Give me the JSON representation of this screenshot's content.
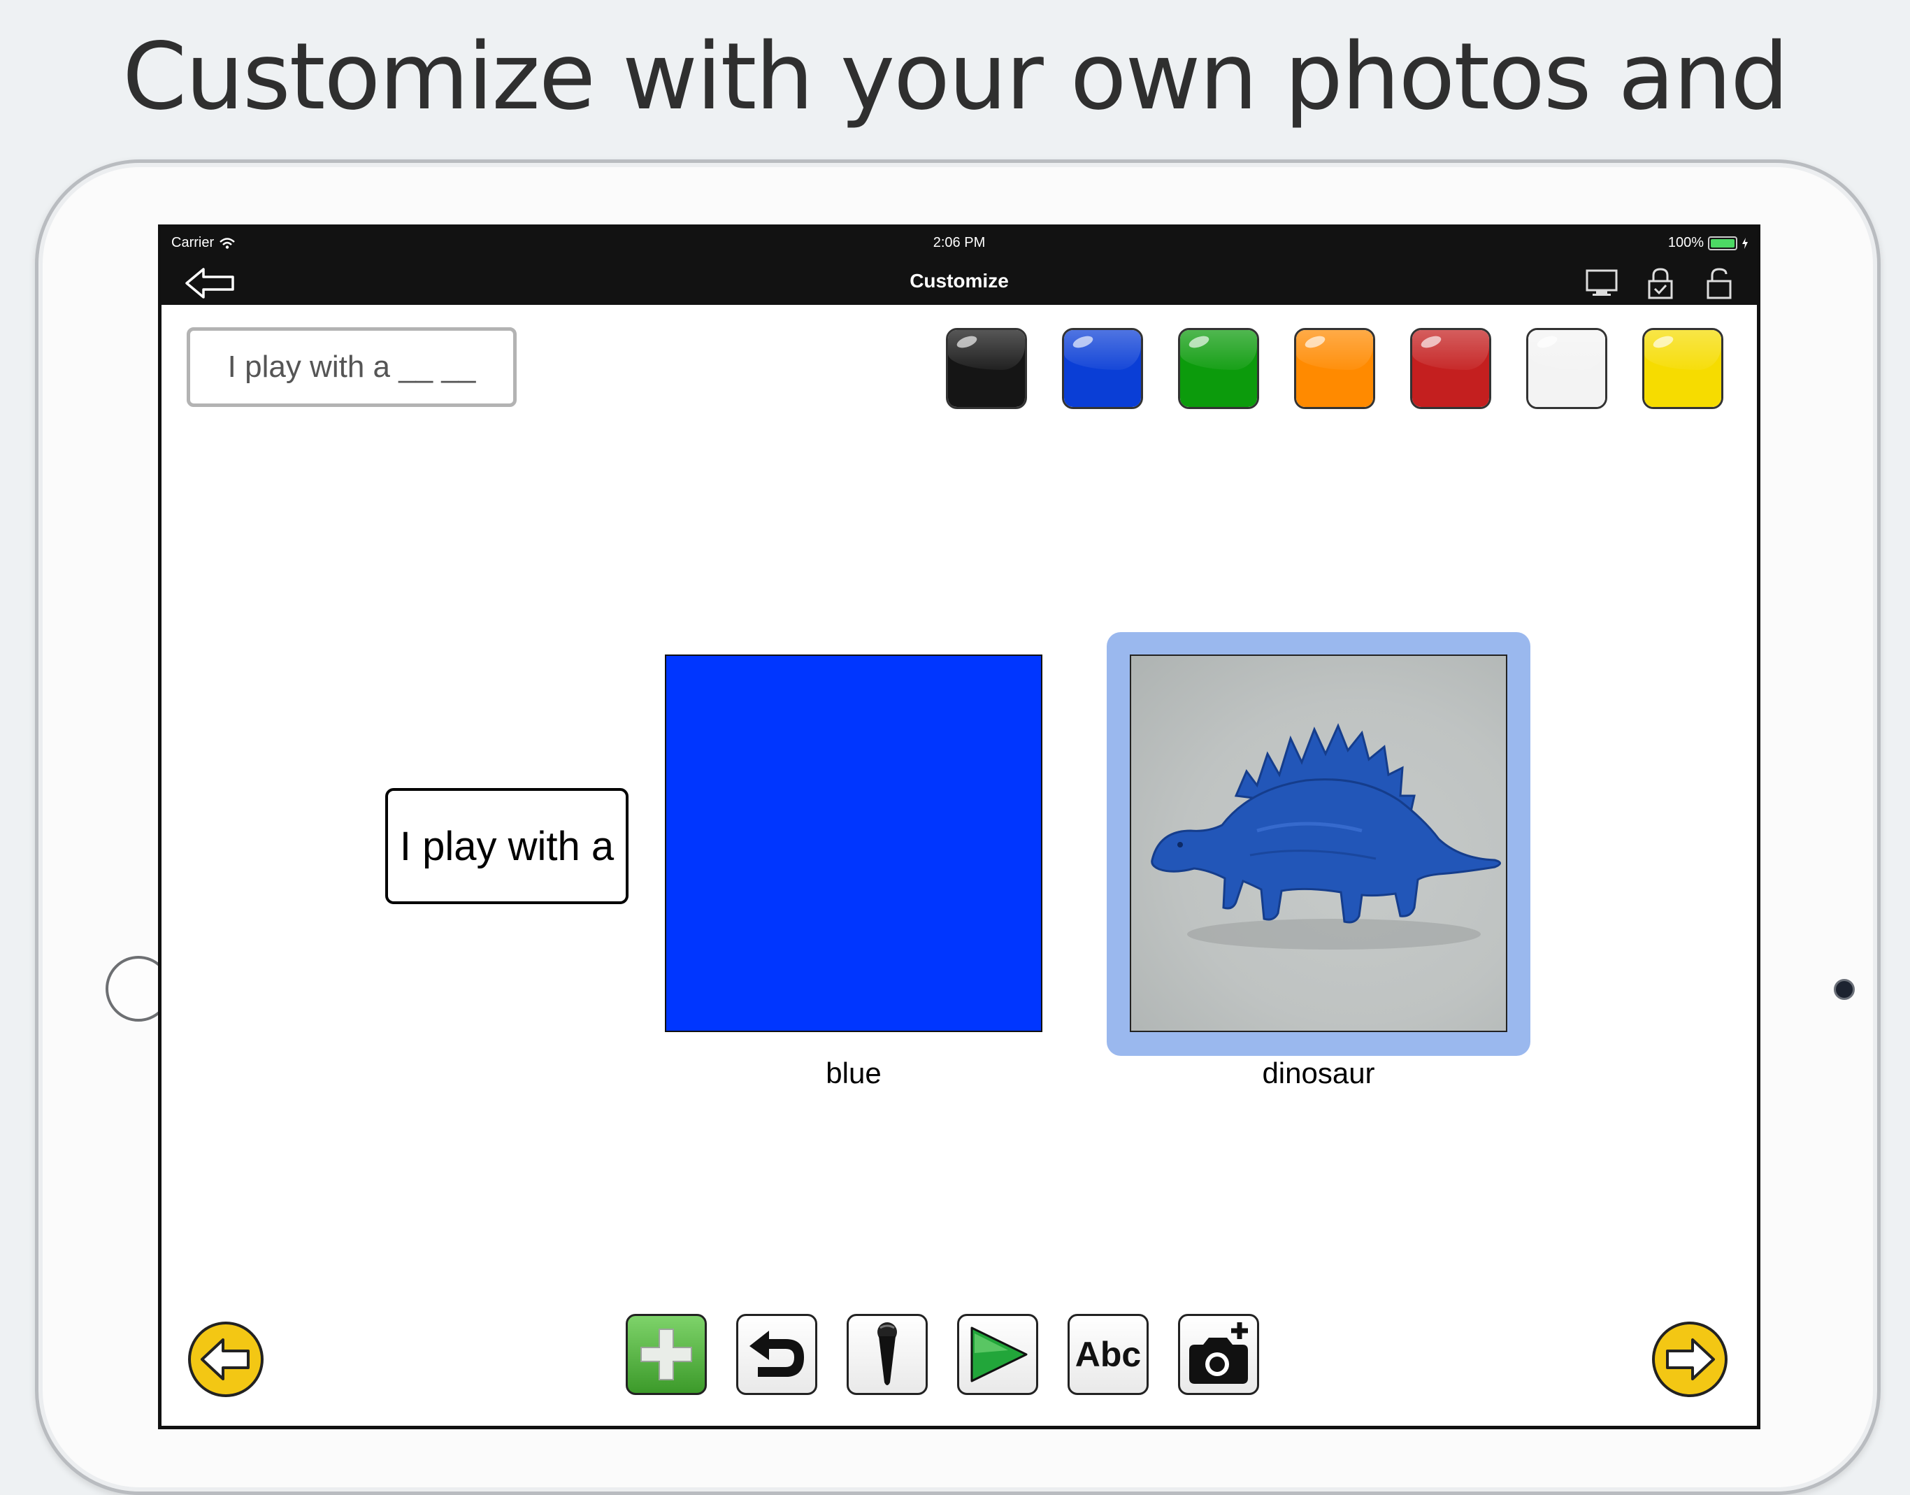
{
  "headline": "Customize with your own photos and voice.",
  "status_bar": {
    "carrier": "Carrier",
    "time": "2:06 PM",
    "battery": "100%"
  },
  "nav": {
    "title": "Customize"
  },
  "prompt_field": {
    "value": "I play with a __ __"
  },
  "color_swatches": [
    {
      "name": "black",
      "color": "#151515"
    },
    {
      "name": "blue",
      "color": "#0a3ed6"
    },
    {
      "name": "green",
      "color": "#0c9b0c"
    },
    {
      "name": "orange",
      "color": "#ff8a00"
    },
    {
      "name": "red",
      "color": "#c41f1f"
    },
    {
      "name": "white",
      "color": "#f3f3f3"
    },
    {
      "name": "yellow",
      "color": "#f6dc00"
    }
  ],
  "sentence_card": {
    "text": "I play with a"
  },
  "cards": [
    {
      "label": "blue",
      "color": "#0036ff"
    },
    {
      "label": "dinosaur"
    }
  ],
  "toolbar": {
    "add": "plus-icon",
    "undo": "undo-icon",
    "record": "microphone-icon",
    "play": "play-icon",
    "text": "Abc",
    "add_photo": "camera-plus-icon"
  },
  "accent_colors": {
    "selection": "#9ab8ee",
    "arrow_yellow": "#f3c714"
  }
}
